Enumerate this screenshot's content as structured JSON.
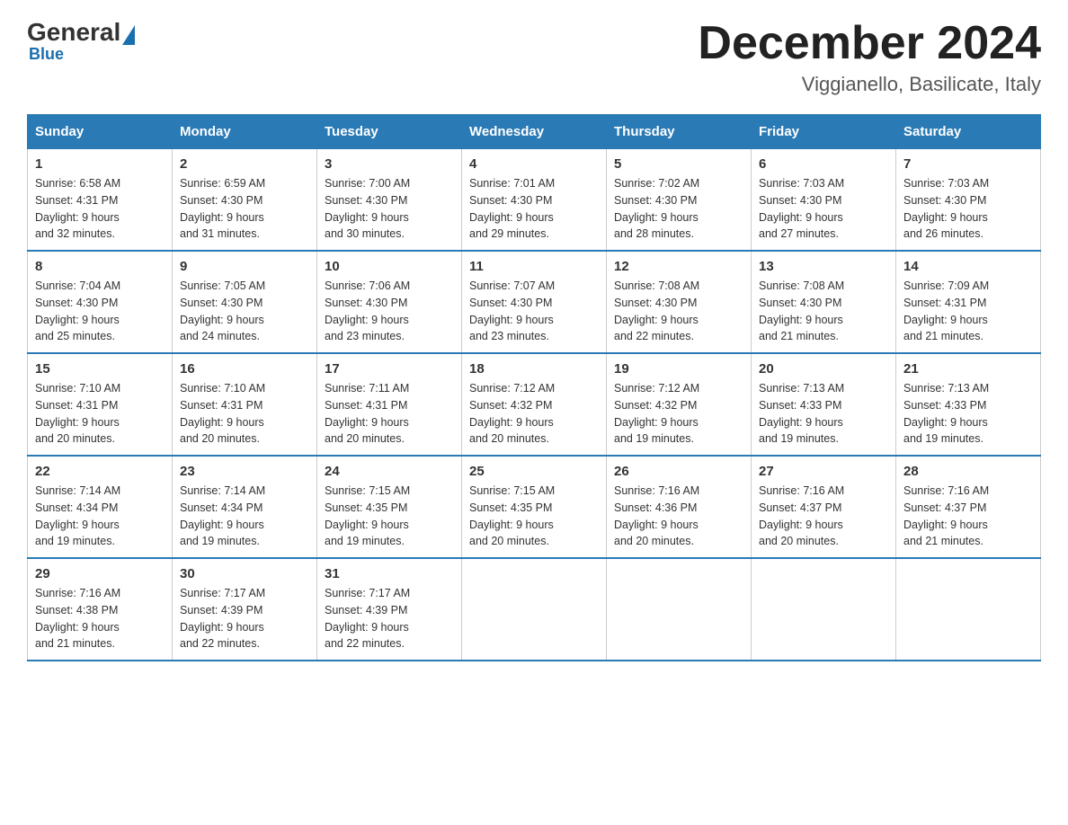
{
  "header": {
    "logo_general": "General",
    "logo_blue": "Blue",
    "month_title": "December 2024",
    "location": "Viggianello, Basilicate, Italy"
  },
  "days_of_week": [
    "Sunday",
    "Monday",
    "Tuesday",
    "Wednesday",
    "Thursday",
    "Friday",
    "Saturday"
  ],
  "weeks": [
    [
      {
        "day": "1",
        "sunrise": "6:58 AM",
        "sunset": "4:31 PM",
        "daylight": "9 hours and 32 minutes."
      },
      {
        "day": "2",
        "sunrise": "6:59 AM",
        "sunset": "4:30 PM",
        "daylight": "9 hours and 31 minutes."
      },
      {
        "day": "3",
        "sunrise": "7:00 AM",
        "sunset": "4:30 PM",
        "daylight": "9 hours and 30 minutes."
      },
      {
        "day": "4",
        "sunrise": "7:01 AM",
        "sunset": "4:30 PM",
        "daylight": "9 hours and 29 minutes."
      },
      {
        "day": "5",
        "sunrise": "7:02 AM",
        "sunset": "4:30 PM",
        "daylight": "9 hours and 28 minutes."
      },
      {
        "day": "6",
        "sunrise": "7:03 AM",
        "sunset": "4:30 PM",
        "daylight": "9 hours and 27 minutes."
      },
      {
        "day": "7",
        "sunrise": "7:03 AM",
        "sunset": "4:30 PM",
        "daylight": "9 hours and 26 minutes."
      }
    ],
    [
      {
        "day": "8",
        "sunrise": "7:04 AM",
        "sunset": "4:30 PM",
        "daylight": "9 hours and 25 minutes."
      },
      {
        "day": "9",
        "sunrise": "7:05 AM",
        "sunset": "4:30 PM",
        "daylight": "9 hours and 24 minutes."
      },
      {
        "day": "10",
        "sunrise": "7:06 AM",
        "sunset": "4:30 PM",
        "daylight": "9 hours and 23 minutes."
      },
      {
        "day": "11",
        "sunrise": "7:07 AM",
        "sunset": "4:30 PM",
        "daylight": "9 hours and 23 minutes."
      },
      {
        "day": "12",
        "sunrise": "7:08 AM",
        "sunset": "4:30 PM",
        "daylight": "9 hours and 22 minutes."
      },
      {
        "day": "13",
        "sunrise": "7:08 AM",
        "sunset": "4:30 PM",
        "daylight": "9 hours and 21 minutes."
      },
      {
        "day": "14",
        "sunrise": "7:09 AM",
        "sunset": "4:31 PM",
        "daylight": "9 hours and 21 minutes."
      }
    ],
    [
      {
        "day": "15",
        "sunrise": "7:10 AM",
        "sunset": "4:31 PM",
        "daylight": "9 hours and 20 minutes."
      },
      {
        "day": "16",
        "sunrise": "7:10 AM",
        "sunset": "4:31 PM",
        "daylight": "9 hours and 20 minutes."
      },
      {
        "day": "17",
        "sunrise": "7:11 AM",
        "sunset": "4:31 PM",
        "daylight": "9 hours and 20 minutes."
      },
      {
        "day": "18",
        "sunrise": "7:12 AM",
        "sunset": "4:32 PM",
        "daylight": "9 hours and 20 minutes."
      },
      {
        "day": "19",
        "sunrise": "7:12 AM",
        "sunset": "4:32 PM",
        "daylight": "9 hours and 19 minutes."
      },
      {
        "day": "20",
        "sunrise": "7:13 AM",
        "sunset": "4:33 PM",
        "daylight": "9 hours and 19 minutes."
      },
      {
        "day": "21",
        "sunrise": "7:13 AM",
        "sunset": "4:33 PM",
        "daylight": "9 hours and 19 minutes."
      }
    ],
    [
      {
        "day": "22",
        "sunrise": "7:14 AM",
        "sunset": "4:34 PM",
        "daylight": "9 hours and 19 minutes."
      },
      {
        "day": "23",
        "sunrise": "7:14 AM",
        "sunset": "4:34 PM",
        "daylight": "9 hours and 19 minutes."
      },
      {
        "day": "24",
        "sunrise": "7:15 AM",
        "sunset": "4:35 PM",
        "daylight": "9 hours and 19 minutes."
      },
      {
        "day": "25",
        "sunrise": "7:15 AM",
        "sunset": "4:35 PM",
        "daylight": "9 hours and 20 minutes."
      },
      {
        "day": "26",
        "sunrise": "7:16 AM",
        "sunset": "4:36 PM",
        "daylight": "9 hours and 20 minutes."
      },
      {
        "day": "27",
        "sunrise": "7:16 AM",
        "sunset": "4:37 PM",
        "daylight": "9 hours and 20 minutes."
      },
      {
        "day": "28",
        "sunrise": "7:16 AM",
        "sunset": "4:37 PM",
        "daylight": "9 hours and 21 minutes."
      }
    ],
    [
      {
        "day": "29",
        "sunrise": "7:16 AM",
        "sunset": "4:38 PM",
        "daylight": "9 hours and 21 minutes."
      },
      {
        "day": "30",
        "sunrise": "7:17 AM",
        "sunset": "4:39 PM",
        "daylight": "9 hours and 22 minutes."
      },
      {
        "day": "31",
        "sunrise": "7:17 AM",
        "sunset": "4:39 PM",
        "daylight": "9 hours and 22 minutes."
      },
      null,
      null,
      null,
      null
    ]
  ],
  "labels": {
    "sunrise": "Sunrise:",
    "sunset": "Sunset:",
    "daylight": "Daylight:"
  }
}
